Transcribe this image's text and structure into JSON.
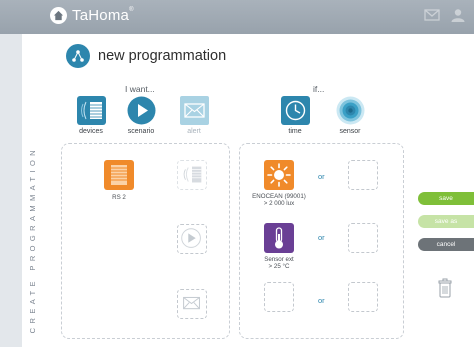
{
  "app": {
    "brand": "TaHoma",
    "brand_mark": "®"
  },
  "page": {
    "title": "new programmation",
    "side_label": "CREATE PROGRAMMATION"
  },
  "i_want": {
    "label": "I want...",
    "types": [
      {
        "label": "devices",
        "icon": "devices-icon"
      },
      {
        "label": "scenario",
        "icon": "play-icon"
      },
      {
        "label": "alert",
        "icon": "envelope-icon"
      }
    ]
  },
  "if": {
    "label": "if...",
    "types": [
      {
        "label": "time",
        "icon": "clock-icon"
      },
      {
        "label": "sensor",
        "icon": "sensor-icon"
      }
    ]
  },
  "actions": {
    "items": [
      {
        "label": "RS 2",
        "icon": "roller-shutter-icon"
      }
    ]
  },
  "conditions": {
    "or_label": "or",
    "rows": [
      {
        "name": "ENOCEAN (99001)",
        "value": "> 2 000 lux",
        "icon": "sun-icon"
      },
      {
        "name": "Sensor ext",
        "value": "> 25 °C",
        "icon": "thermometer-icon"
      }
    ]
  },
  "buttons": {
    "save": "save",
    "save_as": "save as",
    "cancel": "cancel"
  },
  "colors": {
    "accent": "#2d86ad",
    "device_orange": "#f08a2a",
    "sensor_purple": "#6a3f95",
    "save_green": "#7fbf39",
    "cancel_grey": "#6d7378"
  }
}
